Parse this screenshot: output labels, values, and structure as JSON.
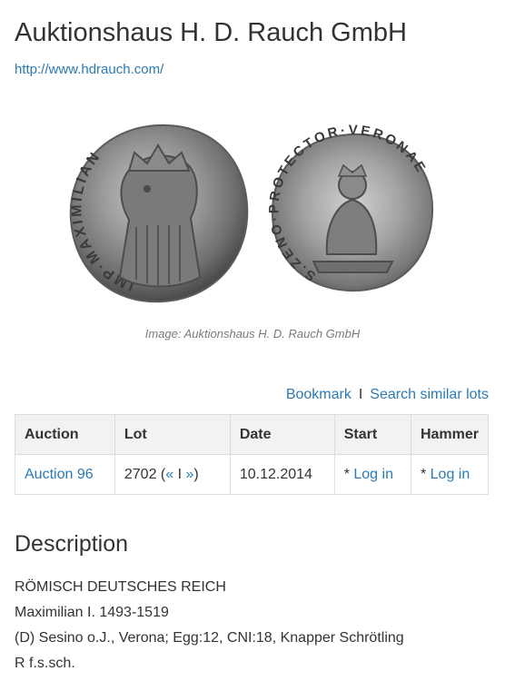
{
  "header": {
    "title": "Auktionshaus H. D. Rauch GmbH",
    "url": "http://www.hdrauch.com/"
  },
  "image": {
    "caption": "Image: Auktionshaus H. D. Rauch GmbH",
    "obverse_legend": "IMP·MAXIMILIAN",
    "reverse_legend": "S.ZENO·PROTECTOR·VERONAE"
  },
  "actions": {
    "bookmark": "Bookmark",
    "separator": "I",
    "search_similar": "Search similar lots"
  },
  "table": {
    "headers": [
      "Auction",
      "Lot",
      "Date",
      "Start",
      "Hammer"
    ],
    "row": {
      "auction": "Auction 96",
      "lot": "2702",
      "lot_prev": "«",
      "lot_sep": "I",
      "lot_next": "»",
      "date": "10.12.2014",
      "start_prefix": "*",
      "start_link": "Log in",
      "hammer_prefix": "*",
      "hammer_link": "Log in"
    }
  },
  "description": {
    "title": "Description",
    "lines": [
      "RÖMISCH DEUTSCHES REICH",
      "Maximilian I. 1493-1519",
      "(D) Sesino o.J., Verona; Egg:12, CNI:18, Knapper Schrötling",
      "R f.s.sch."
    ]
  },
  "colors": {
    "link": "#2a7ab9",
    "text": "#333333",
    "caption": "#7a7a7a",
    "table_header_bg": "#f2f2f2",
    "border": "#dddddd",
    "coin_silver": "#8c8c8c"
  }
}
